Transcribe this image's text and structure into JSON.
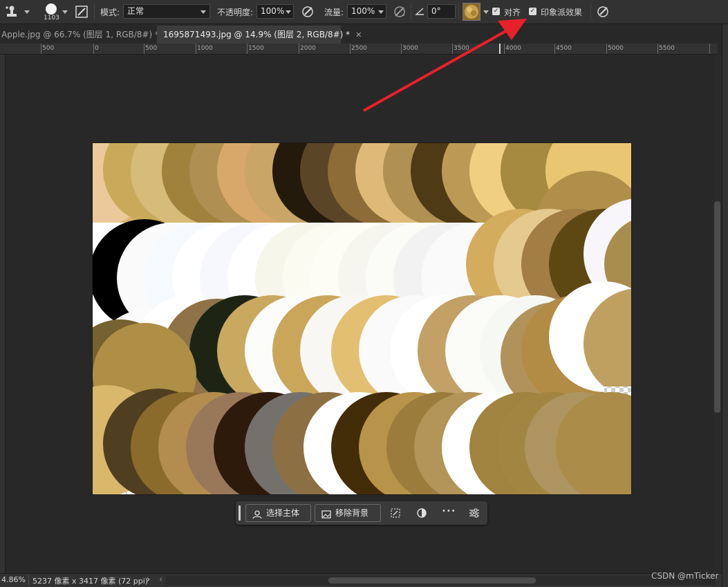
{
  "options_bar": {
    "brush_size": "1103",
    "mode_label": "模式:",
    "mode_value": "正常",
    "opacity_label": "不透明度:",
    "opacity_value": "100%",
    "flow_label": "流量:",
    "flow_value": "100%",
    "angle_value": "0°",
    "align_label": "对齐",
    "align_checked": true,
    "impressionist_label": "印象派效果",
    "impressionist_checked": true
  },
  "tabs": [
    {
      "label": "Apple.jpg @ 66.7% (图层 1, RGB/8#) *",
      "active": false
    },
    {
      "label": "1695871493.jpg @ 14.9% (图层 2, RGB/8#) *",
      "active": true
    }
  ],
  "ruler": {
    "labels": [
      "500",
      "0",
      "500",
      "1000",
      "1500",
      "2000",
      "2500",
      "3000",
      "3500",
      "4000",
      "4500",
      "5000",
      "5500"
    ]
  },
  "task_bar": {
    "select_subject": "选择主体",
    "remove_background": "移除背景",
    "more": "•••"
  },
  "status_bar": {
    "zoom": "4.86%",
    "doc_info": "5237 像素 x 3417 像素 (72 ppi)",
    "arrow_right": "›",
    "arrow_left": "‹"
  },
  "watermark": "CSDN @mTicker",
  "colors": {
    "app_bg": "#282828",
    "panel_bg": "#323232",
    "annotation_arrow": "#e8202a"
  },
  "icons": {
    "tool": "clone-stamp-icon",
    "brush_preset": "brush-preset-icon",
    "brush_panel": "brush-settings-icon",
    "opacity_pressure": "pressure-opacity-icon",
    "airbrush": "airbrush-icon",
    "angle": "angle-icon",
    "pattern": "pattern-swatch-icon",
    "size_pressure": "pressure-size-icon"
  }
}
